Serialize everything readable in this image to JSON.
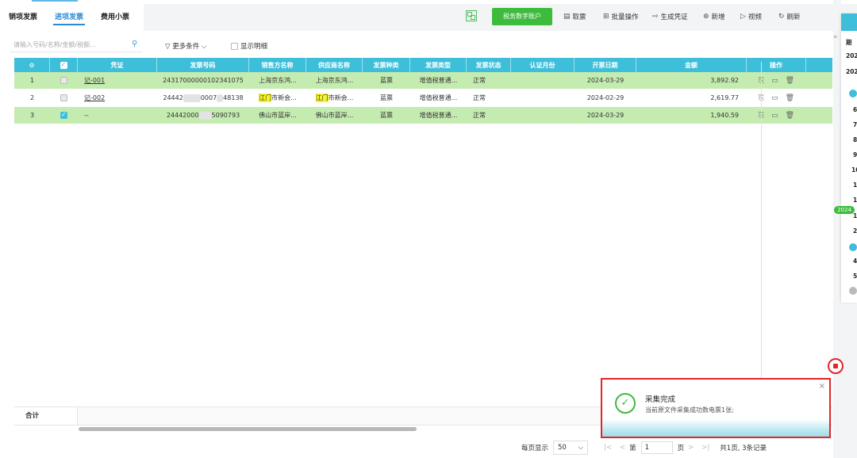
{
  "tabs": [
    {
      "label": "销项发票",
      "active": false
    },
    {
      "label": "进项发票",
      "active": true
    },
    {
      "label": "费用小票",
      "active": false
    }
  ],
  "toolbar": {
    "qr_icon": "qrcode-icon",
    "tax_account_button": "税务数字账户",
    "fetch_ticket": "取票",
    "batch_operation": "批量操作",
    "generate_voucher": "生成凭证",
    "add_new": "新增",
    "video": "视频",
    "refresh": "刷新"
  },
  "filters": {
    "search_placeholder": "请输入号码/名称/金额/税额...",
    "more_conditions": "更多条件",
    "show_detail": "显示明细"
  },
  "table": {
    "columns": [
      "凭证",
      "发票号码",
      "销售方名称",
      "供应商名称",
      "发票种类",
      "发票类型",
      "发票状态",
      "认证月份",
      "开票日期",
      "金额",
      "操作"
    ],
    "rows": [
      {
        "index": "1",
        "checked": false,
        "voucher": "记-001",
        "invoice_no": "24317000000102341075",
        "seller": "上海京东鸿...",
        "seller_hl": "",
        "supplier": "上海京东鸿...",
        "supplier_hl": "",
        "kind": "蓝票",
        "type": "增值税普通...",
        "status": "正常",
        "auth_month": "",
        "date": "2024-03-29",
        "amount": "3,892.92",
        "style": "green"
      },
      {
        "index": "2",
        "checked": false,
        "voucher": "记-002",
        "invoice_no_a": "24442",
        "invoice_no_b": "0007",
        "invoice_no_c": "48138",
        "seller": "市新会...",
        "seller_hl": "江门",
        "supplier": "市新会...",
        "supplier_hl": "江门",
        "kind": "蓝票",
        "type": "增值税普通...",
        "status": "正常",
        "auth_month": "",
        "date": "2024-02-29",
        "amount": "2,619.77",
        "style": "white"
      },
      {
        "index": "3",
        "checked": true,
        "voucher": "--",
        "invoice_no_a": "24442000",
        "invoice_no_c": "5090793",
        "seller": "佛山市蓝岸...",
        "seller_hl": "",
        "supplier": "佛山市蓝岸...",
        "supplier_hl": "",
        "kind": "蓝票",
        "type": "增值税普通...",
        "status": "正常",
        "auth_month": "",
        "date": "2024-03-29",
        "amount": "1,940.59",
        "style": "green"
      }
    ],
    "sum_label": "合计"
  },
  "pagination": {
    "per_page_label": "每页显示",
    "per_page_value": "50",
    "page_prefix": "第",
    "page_value": "1",
    "page_suffix": "页",
    "summary": "共1页, 3条记录"
  },
  "side_panel": {
    "header": "期",
    "lines": [
      "202",
      "202",
      "6",
      "7",
      "8",
      "9",
      "10",
      "1",
      "1",
      "1",
      "2",
      "4",
      "5"
    ],
    "year_badge": "2024",
    "accent_color": "#3dbfd9"
  },
  "toast": {
    "title": "采集完成",
    "message": "当前原文件采集成功数电票1张;"
  },
  "colors": {
    "header": "#3dbfd9",
    "row_highlight": "#c4ebb0",
    "primary_green": "#3dbb3d",
    "red_outline": "#e0262a"
  }
}
